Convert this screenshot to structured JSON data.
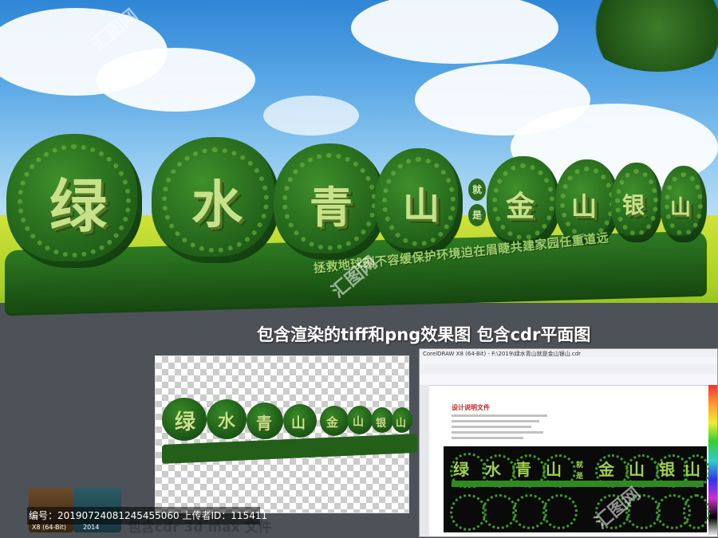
{
  "sign": {
    "glyphs": [
      "绿",
      "水",
      "青",
      "山",
      "金",
      "山",
      "银",
      "山"
    ],
    "connector": [
      "就",
      "是"
    ],
    "slogan": "拯救地球刻不容缓保护环境迫在眉睫共建家园任重道远"
  },
  "caption": "包含渲染的tiff和png效果图  包含cdr平面图",
  "preview_left": {
    "glyphs": [
      "绿",
      "水",
      "青",
      "山",
      "金",
      "山",
      "银",
      "山"
    ]
  },
  "preview_right": {
    "title": "CorelDRAW X8 (64-Bit) - F:\\2019\\绿水青山就是金山银山.cdr",
    "doc_heading": "设计说明文件",
    "glyphs_row1": [
      "绿",
      "水",
      "青",
      "山",
      "金",
      "山",
      "银",
      "山"
    ],
    "connector": [
      "就",
      "是"
    ]
  },
  "footer": {
    "text": "编号：20190724081245455060 上传者ID：115411",
    "tile1_label": "X8 (64-Bit)",
    "tile2_label": "2014",
    "underlay": "包含cdr 3d max 文件"
  },
  "watermark": "汇图网",
  "colors": {
    "sign_green": "#1f5c17",
    "glyph": "#c7e08a",
    "sky": "#5aa8e6"
  }
}
